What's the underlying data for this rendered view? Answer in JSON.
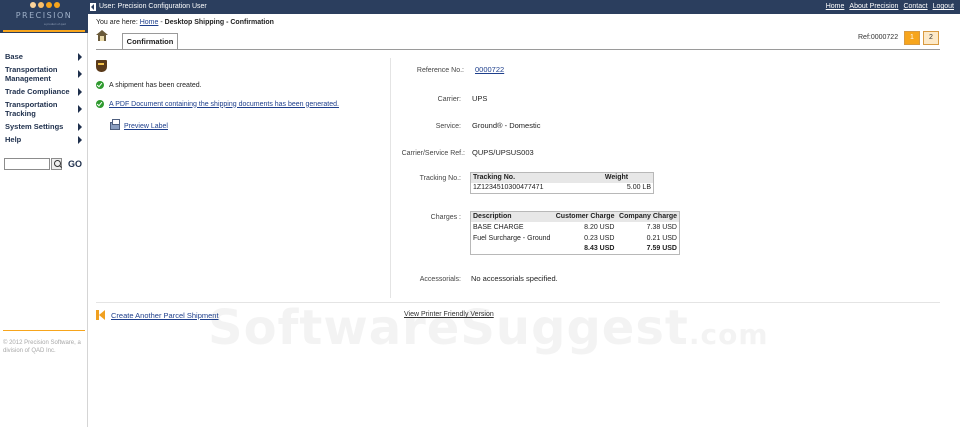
{
  "brand": {
    "logo_word": "PRECISION",
    "logo_tag": "a product of qad",
    "colors": {
      "nav": "#2b3e5e",
      "accent": "#f7a51c",
      "link": "#1e3f8c"
    }
  },
  "topbar": {
    "user": "User: Precision Configuration User",
    "links": [
      "Home",
      "About Precision",
      "Contact",
      "Logout"
    ]
  },
  "sidebar": {
    "items": [
      {
        "label": "Base"
      },
      {
        "label": "Transportation Management"
      },
      {
        "label": "Trade Compliance"
      },
      {
        "label": "Transportation Tracking"
      },
      {
        "label": "System Settings"
      },
      {
        "label": "Help"
      }
    ],
    "search": {
      "placeholder": "",
      "go_label": "GO"
    },
    "copyright": "© 2012 Precision Software, a division of QAD Inc."
  },
  "breadcrumb": {
    "prefix": "You are here:",
    "home": "Home",
    "separator": " - ",
    "trail": "Desktop Shipping - Confirmation"
  },
  "tabs": [
    {
      "label": "Confirmation"
    }
  ],
  "ref": {
    "label": "Ref:0000722",
    "pages": [
      "1",
      "2"
    ]
  },
  "messages": {
    "shipment_created": "A shipment has been created.",
    "pdf_generated": "A PDF Document containing the shipping documents has been generated.",
    "preview_label": "Preview Label"
  },
  "details": {
    "reference": {
      "label": "Reference No.:",
      "value": "0000722"
    },
    "carrier": {
      "label": "Carrier:",
      "value": "UPS"
    },
    "service": {
      "label": "Service:",
      "value": "Ground® - Domestic"
    },
    "carrier_service_ref": {
      "label": "Carrier/Service Ref.:",
      "value": "QUPS/UPSUS003"
    },
    "tracking": {
      "label": "Tracking No.:",
      "headers": [
        "Tracking No.",
        "Weight"
      ],
      "rows": [
        [
          "1Z1234510300477471",
          "5.00 LB"
        ]
      ]
    },
    "charges": {
      "label": "Charges :",
      "headers": [
        "Description",
        "Customer Charge",
        "Company Charge"
      ],
      "rows": [
        [
          "BASE CHARGE",
          "8.20 USD",
          "7.38 USD"
        ],
        [
          "Fuel Surcharge - Ground",
          "0.23 USD",
          "0.21 USD"
        ]
      ],
      "totals": [
        "",
        "8.43 USD",
        "7.59 USD"
      ]
    },
    "accessorials": {
      "label": "Accessorials:",
      "value": "No accessorials specified."
    }
  },
  "footer": {
    "create_another": "Create Another Parcel Shipment",
    "printer_friendly": "View Printer Friendly Version"
  },
  "watermark": {
    "text": "SoftwareSuggest",
    "suffix": ".com"
  }
}
